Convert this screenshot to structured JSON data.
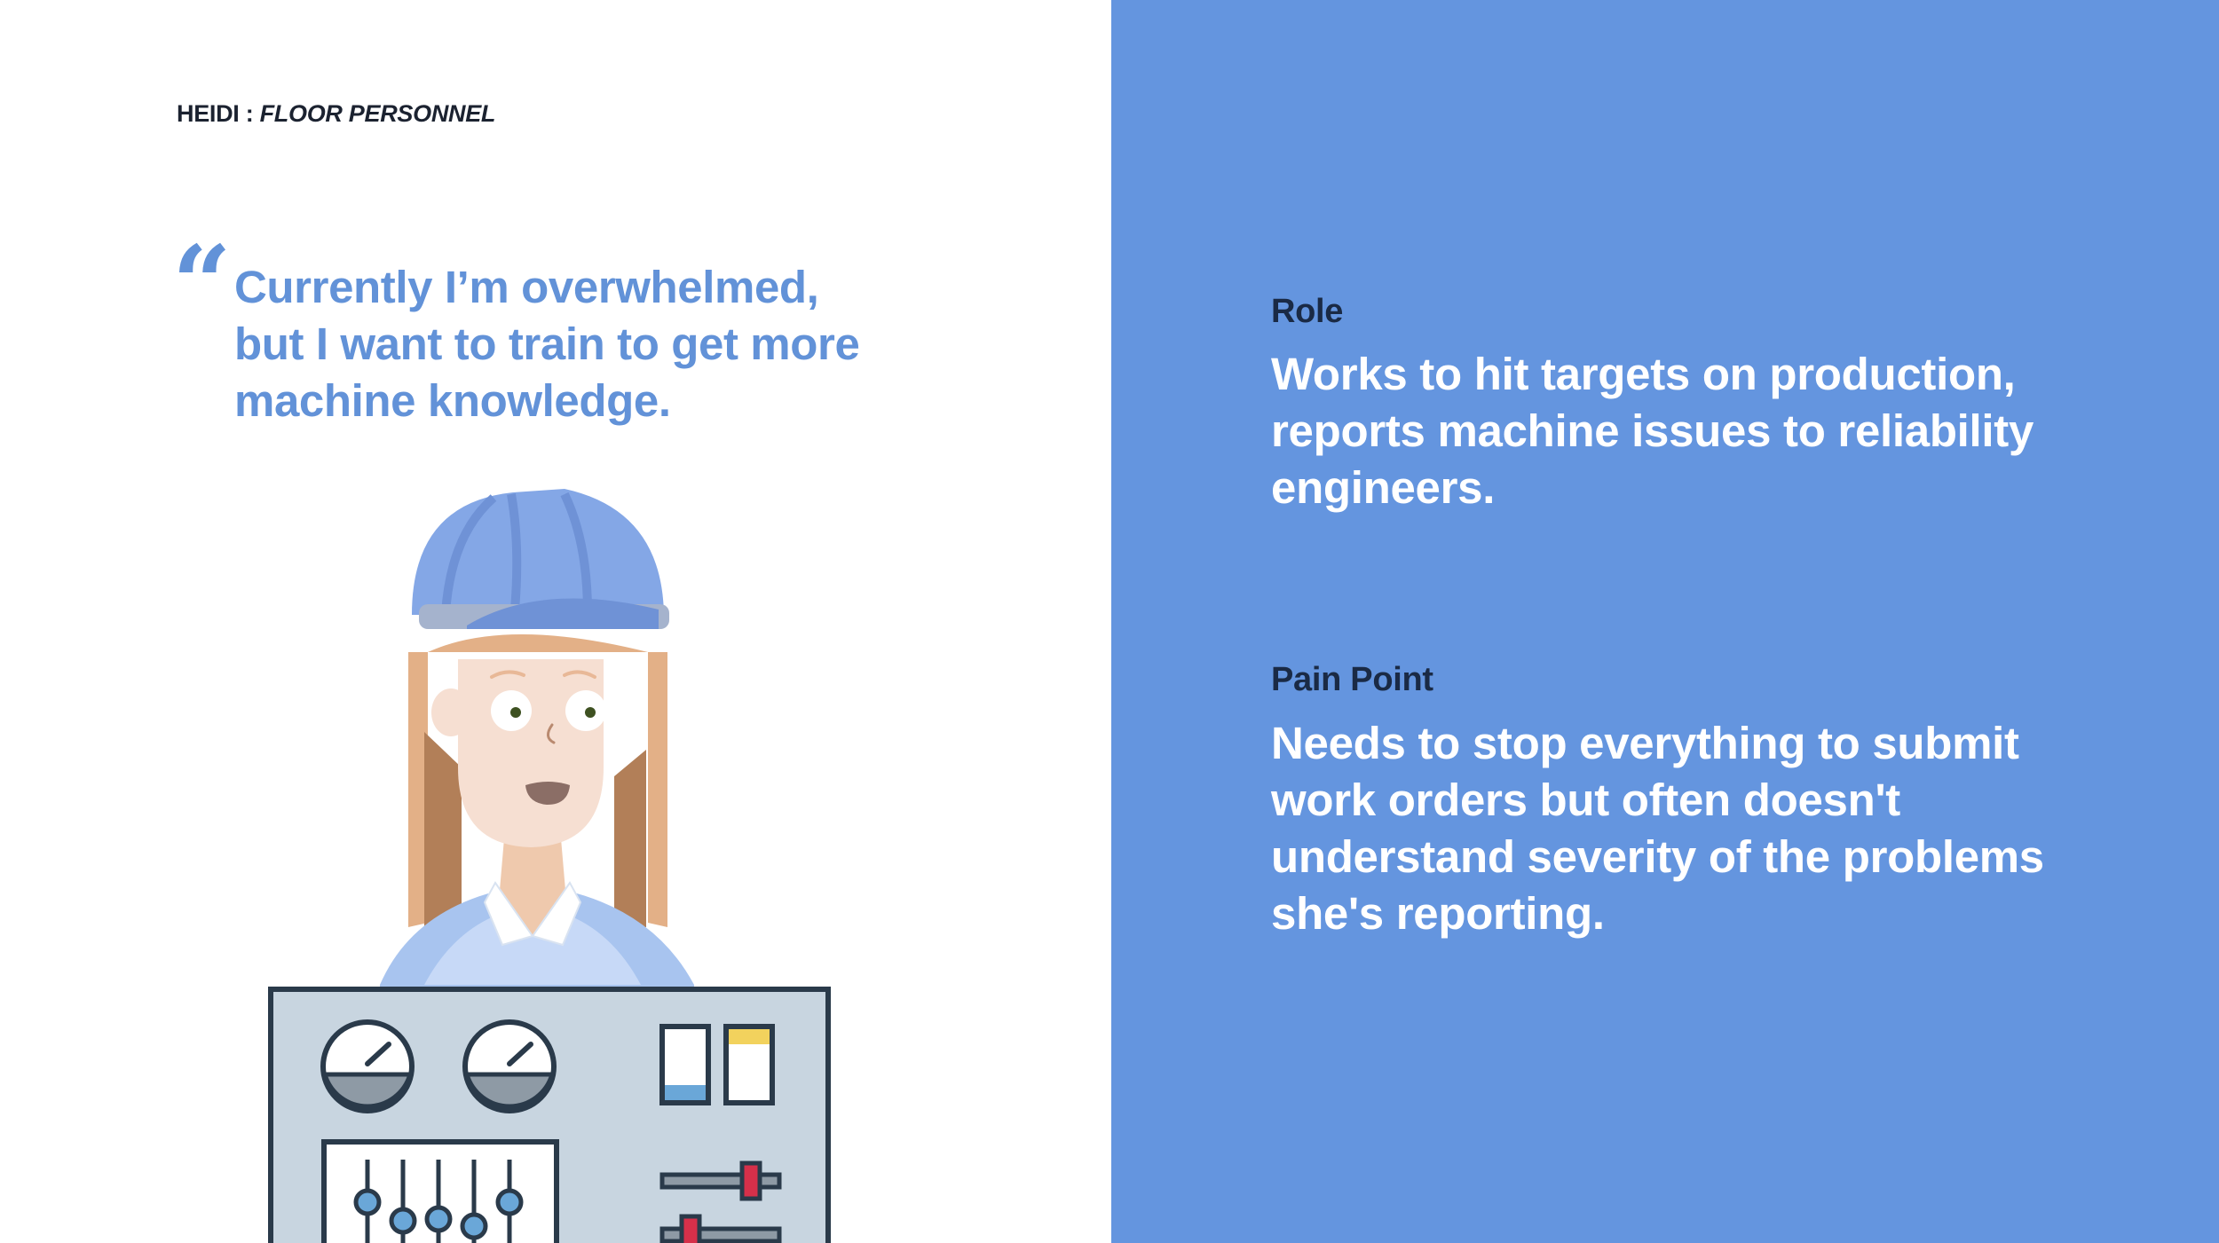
{
  "persona": {
    "name": "HEIDI :",
    "role": "FLOOR PERSONNEL"
  },
  "quote": {
    "mark": "“",
    "text": "Currently I’m overwhelmed,\nbut I want to train to get more\nmachine knowledge."
  },
  "role_section": {
    "heading": "Role",
    "body": "Works to hit targets on production,\nreports machine issues to reliability\nengineers."
  },
  "pain_point_section": {
    "heading": "Pain Point",
    "body": "Needs to stop everything to submit\nwork orders but often doesn't\nunderstand severity of the problems\nshe's reporting."
  },
  "colors": {
    "accent_blue": "#6495df",
    "quote_blue": "#6292d8",
    "heading_navy": "#1a2a45",
    "text_dark": "#1b2230",
    "panel_gray": "#c8d5e0"
  },
  "illustration": {
    "subject": "worker-with-control-panel",
    "icons": [
      "hard-hat-icon",
      "gauge-icon",
      "slider-icon",
      "indicator-icon"
    ]
  }
}
